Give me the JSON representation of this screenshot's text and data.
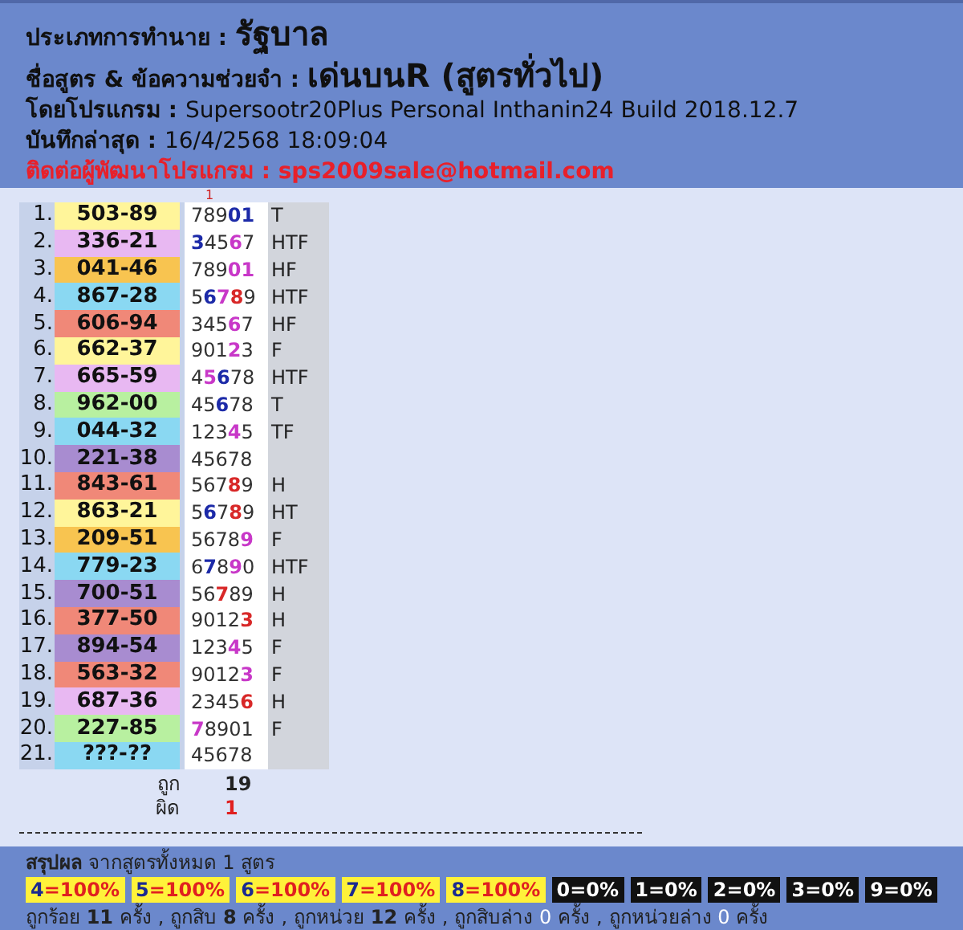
{
  "header": {
    "type_label": "ประเภทการทำนาย :",
    "type_value": "รัฐบาล",
    "formula_label": "ชื่อสูตร & ข้อความช่วยจำ :",
    "formula_value": "เด่นบนR (สูตรทั่วไป)",
    "program_label": "โดยโปรแกรม :",
    "program_value": "Supersootr20Plus Personal Inthanin24 Build 2018.12.7",
    "saved_label": "บันทึกล่าสุด :",
    "saved_value": "16/4/2568 18:09:04",
    "contact": "ติดต่อผู้พัฒนาโปรแกรม : sps2009sale@hotmail.com"
  },
  "column_marker": "1",
  "rows": [
    {
      "no": "1.",
      "number": "503-89",
      "color": "#fff59a",
      "digits": [
        {
          "d": "7"
        },
        {
          "d": "8"
        },
        {
          "d": "9"
        },
        {
          "d": "0",
          "color": "#1c2aa8"
        },
        {
          "d": "1",
          "color": "#1c2aa8"
        }
      ],
      "result": "T"
    },
    {
      "no": "2.",
      "number": "336-21",
      "color": "#e8b8f2",
      "digits": [
        {
          "d": "3",
          "color": "#1c2aa8"
        },
        {
          "d": "4"
        },
        {
          "d": "5"
        },
        {
          "d": "6",
          "color": "#c838c8"
        },
        {
          "d": "7"
        }
      ],
      "result": "HTF"
    },
    {
      "no": "3.",
      "number": "041-46",
      "color": "#f8c450",
      "digits": [
        {
          "d": "7"
        },
        {
          "d": "8"
        },
        {
          "d": "9"
        },
        {
          "d": "0",
          "color": "#c838c8"
        },
        {
          "d": "1",
          "color": "#c838c8"
        }
      ],
      "result": "HF"
    },
    {
      "no": "4.",
      "number": "867-28",
      "color": "#8ad8f2",
      "digits": [
        {
          "d": "5"
        },
        {
          "d": "6",
          "color": "#1c2aa8"
        },
        {
          "d": "7",
          "color": "#c838c8"
        },
        {
          "d": "8",
          "color": "#d82828"
        },
        {
          "d": "9"
        }
      ],
      "result": "HTF"
    },
    {
      "no": "5.",
      "number": "606-94",
      "color": "#f08878",
      "digits": [
        {
          "d": "3"
        },
        {
          "d": "4"
        },
        {
          "d": "5"
        },
        {
          "d": "6",
          "color": "#c838c8"
        },
        {
          "d": "7"
        }
      ],
      "result": "HF"
    },
    {
      "no": "6.",
      "number": "662-37",
      "color": "#fff59a",
      "digits": [
        {
          "d": "9"
        },
        {
          "d": "0"
        },
        {
          "d": "1"
        },
        {
          "d": "2",
          "color": "#c838c8"
        },
        {
          "d": "3"
        }
      ],
      "result": "F"
    },
    {
      "no": "7.",
      "number": "665-59",
      "color": "#e8b8f2",
      "digits": [
        {
          "d": "4"
        },
        {
          "d": "5",
          "color": "#c838c8"
        },
        {
          "d": "6",
          "color": "#1c2aa8"
        },
        {
          "d": "7"
        },
        {
          "d": "8"
        }
      ],
      "result": "HTF"
    },
    {
      "no": "8.",
      "number": "962-00",
      "color": "#b8f0a0",
      "digits": [
        {
          "d": "4"
        },
        {
          "d": "5"
        },
        {
          "d": "6",
          "color": "#1c2aa8"
        },
        {
          "d": "7"
        },
        {
          "d": "8"
        }
      ],
      "result": "T"
    },
    {
      "no": "9.",
      "number": "044-32",
      "color": "#8ad8f2",
      "digits": [
        {
          "d": "1"
        },
        {
          "d": "2"
        },
        {
          "d": "3"
        },
        {
          "d": "4",
          "color": "#c838c8"
        },
        {
          "d": "5"
        }
      ],
      "result": "TF"
    },
    {
      "no": "10.",
      "number": "221-38",
      "color": "#a88cd0",
      "digits": [
        {
          "d": "4"
        },
        {
          "d": "5"
        },
        {
          "d": "6"
        },
        {
          "d": "7"
        },
        {
          "d": "8"
        }
      ],
      "result": ""
    },
    {
      "no": "11.",
      "number": "843-61",
      "color": "#f08878",
      "digits": [
        {
          "d": "5"
        },
        {
          "d": "6"
        },
        {
          "d": "7"
        },
        {
          "d": "8",
          "color": "#d82828"
        },
        {
          "d": "9"
        }
      ],
      "result": "H"
    },
    {
      "no": "12.",
      "number": "863-21",
      "color": "#fff59a",
      "digits": [
        {
          "d": "5"
        },
        {
          "d": "6",
          "color": "#1c2aa8"
        },
        {
          "d": "7"
        },
        {
          "d": "8",
          "color": "#d82828"
        },
        {
          "d": "9"
        }
      ],
      "result": "HT"
    },
    {
      "no": "13.",
      "number": "209-51",
      "color": "#f8c450",
      "digits": [
        {
          "d": "5"
        },
        {
          "d": "6"
        },
        {
          "d": "7"
        },
        {
          "d": "8"
        },
        {
          "d": "9",
          "color": "#c838c8"
        }
      ],
      "result": "F"
    },
    {
      "no": "14.",
      "number": "779-23",
      "color": "#8ad8f2",
      "digits": [
        {
          "d": "6"
        },
        {
          "d": "7",
          "color": "#1c2aa8"
        },
        {
          "d": "8"
        },
        {
          "d": "9",
          "color": "#c838c8"
        },
        {
          "d": "0"
        }
      ],
      "result": "HTF"
    },
    {
      "no": "15.",
      "number": "700-51",
      "color": "#a88cd0",
      "digits": [
        {
          "d": "5"
        },
        {
          "d": "6"
        },
        {
          "d": "7",
          "color": "#d82828"
        },
        {
          "d": "8"
        },
        {
          "d": "9"
        }
      ],
      "result": "H"
    },
    {
      "no": "16.",
      "number": "377-50",
      "color": "#f08878",
      "digits": [
        {
          "d": "9"
        },
        {
          "d": "0"
        },
        {
          "d": "1"
        },
        {
          "d": "2"
        },
        {
          "d": "3",
          "color": "#d82828"
        }
      ],
      "result": "H"
    },
    {
      "no": "17.",
      "number": "894-54",
      "color": "#a88cd0",
      "digits": [
        {
          "d": "1"
        },
        {
          "d": "2"
        },
        {
          "d": "3"
        },
        {
          "d": "4",
          "color": "#c838c8"
        },
        {
          "d": "5"
        }
      ],
      "result": "F"
    },
    {
      "no": "18.",
      "number": "563-32",
      "color": "#f08878",
      "digits": [
        {
          "d": "9"
        },
        {
          "d": "0"
        },
        {
          "d": "1"
        },
        {
          "d": "2"
        },
        {
          "d": "3",
          "color": "#c838c8"
        }
      ],
      "result": "F"
    },
    {
      "no": "19.",
      "number": "687-36",
      "color": "#e8b8f2",
      "digits": [
        {
          "d": "2"
        },
        {
          "d": "3"
        },
        {
          "d": "4"
        },
        {
          "d": "5"
        },
        {
          "d": "6",
          "color": "#d82828"
        }
      ],
      "result": "H"
    },
    {
      "no": "20.",
      "number": "227-85",
      "color": "#b8f0a0",
      "digits": [
        {
          "d": "7",
          "color": "#c838c8"
        },
        {
          "d": "8"
        },
        {
          "d": "9"
        },
        {
          "d": "0"
        },
        {
          "d": "1"
        }
      ],
      "result": "F"
    },
    {
      "no": "21.",
      "number": "???-??",
      "color": "#8ad8f2",
      "digits": [
        {
          "d": "4"
        },
        {
          "d": "5"
        },
        {
          "d": "6"
        },
        {
          "d": "7"
        },
        {
          "d": "8"
        }
      ],
      "result": ""
    }
  ],
  "totals": {
    "correct_label": "ถูก",
    "correct": "19",
    "wrong_label": "ผิด",
    "wrong": "1"
  },
  "summary": {
    "title": "**สรุปผล** จากสูตรทั้งหมด 1 สูตร",
    "badges": [
      {
        "digit": "4",
        "value": "=100%",
        "hit": true
      },
      {
        "digit": "5",
        "value": "=100%",
        "hit": true
      },
      {
        "digit": "6",
        "value": "=100%",
        "hit": true
      },
      {
        "digit": "7",
        "value": "=100%",
        "hit": true
      },
      {
        "digit": "8",
        "value": "=100%",
        "hit": true
      },
      {
        "digit": "0",
        "value": "=0%",
        "hit": false
      },
      {
        "digit": "1",
        "value": "=0%",
        "hit": false
      },
      {
        "digit": "2",
        "value": "=0%",
        "hit": false
      },
      {
        "digit": "3",
        "value": "=0%",
        "hit": false
      },
      {
        "digit": "9",
        "value": "=0%",
        "hit": false
      }
    ],
    "separator": ",",
    "counts": [
      {
        "label": "ถูกร้อย",
        "count": "11",
        "unit": "ครั้ง",
        "hit": true
      },
      {
        "label": "ถูกสิบ",
        "count": "8",
        "unit": "ครั้ง",
        "hit": true
      },
      {
        "label": "ถูกหน่วย",
        "count": "12",
        "unit": "ครั้ง",
        "hit": true
      },
      {
        "label": "ถูกสิบล่าง",
        "count": "0",
        "unit": "ครั้ง",
        "hit": false
      },
      {
        "label": "ถูกหน่วยล่าง",
        "count": "0",
        "unit": "ครั้ง",
        "hit": false
      }
    ]
  }
}
